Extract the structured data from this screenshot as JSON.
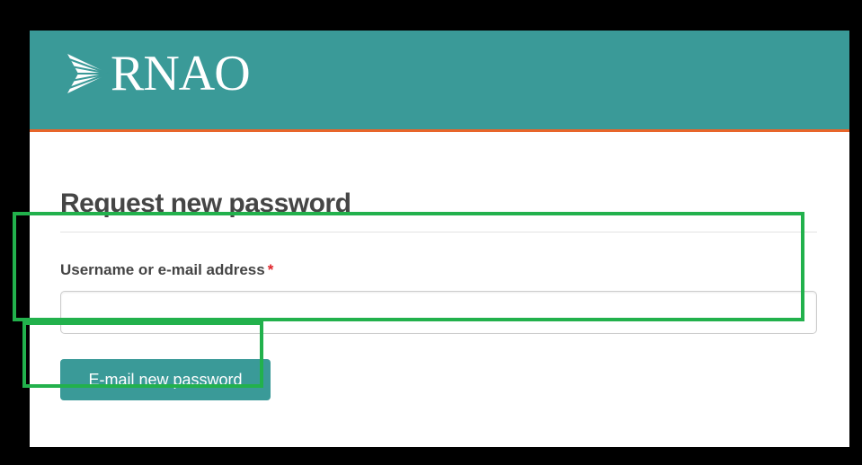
{
  "header": {
    "logo_text": "RNAO",
    "brand_color": "#3a9a98",
    "accent_color": "#e8652a",
    "logo_icon": "sunburst-arrow-icon"
  },
  "main": {
    "title": "Request new password",
    "field_label": "Username or e-mail address",
    "required_mark": "*",
    "field_value": "",
    "submit_label": "E-mail new password"
  },
  "annotations": {
    "highlight_color": "#22b14c"
  }
}
